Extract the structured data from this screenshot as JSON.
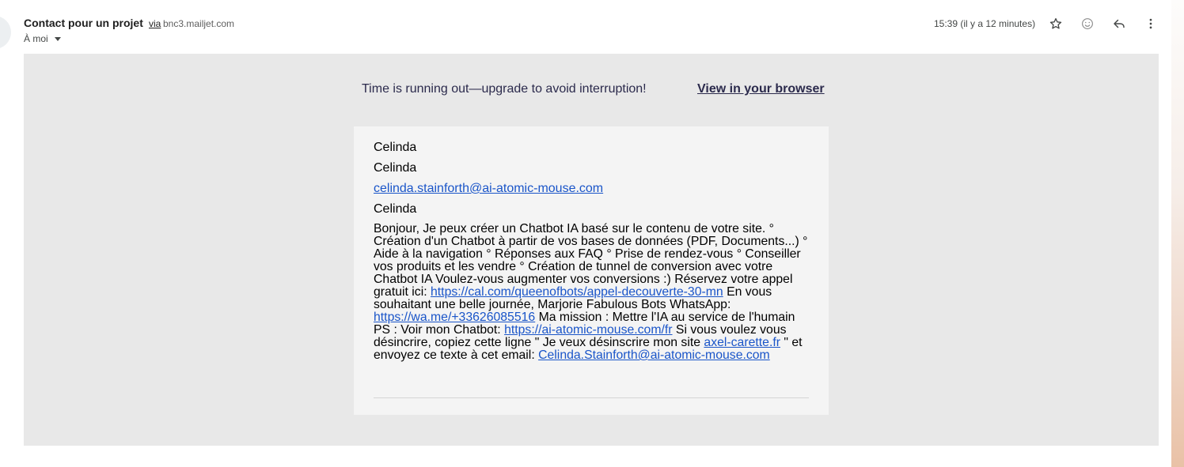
{
  "header": {
    "subject": "Contact pour un projet",
    "via_label": "via",
    "sender_domain": "bnc3.mailjet.com",
    "to_label": "À moi",
    "timestamp": "15:39 (il y a 12 minutes)",
    "icons": [
      "star-icon",
      "emoji-icon",
      "reply-icon",
      "more-vert-icon"
    ]
  },
  "email": {
    "promo_text": "Time is running out—upgrade to avoid interruption!",
    "view_in_browser": "View in your browser",
    "fields": [
      "Celinda",
      "Celinda",
      "celinda.stainforth@ai-atomic-mouse.com",
      "Celinda"
    ],
    "message": {
      "part1": "Bonjour, Je peux créer un Chatbot IA basé sur le contenu de votre site. ° Création d'un Chatbot à partir de vos bases de données (PDF, Documents...) ° Aide à la navigation ° Réponses aux FAQ ° Prise de rendez-vous ° Conseiller vos produits et les vendre ° Création de tunnel de conversion avec votre Chatbot IA Voulez-vous augmenter vos conversions :) Réservez votre appel gratuit ici: ",
      "link1": "https://cal.com/queenofbots/appel-decouverte-30-mn",
      "part2": " En vous souhaitant une belle journée, Marjorie Fabulous Bots WhatsApp: ",
      "link2": "https://wa.me/+33626085516",
      "part3": " Ma mission : Mettre l'IA au service de l'humain PS : Voir mon Chatbot: ",
      "link3": "https://ai-atomic-mouse.com/fr",
      "part4": " Si vous voulez vous désincrire, copiez cette ligne \" Je veux désinscrire mon site ",
      "link4": "axel-carette.fr",
      "part5": " \" et envoyez ce texte à cet email: ",
      "link5": "Celinda.Stainforth@ai-atomic-mouse.com"
    }
  },
  "colors": {
    "body_bg": "#e8e8e8",
    "card_bg": "#f4f4f4",
    "link": "#1a55c9",
    "promo_text": "#2b2a4c"
  }
}
